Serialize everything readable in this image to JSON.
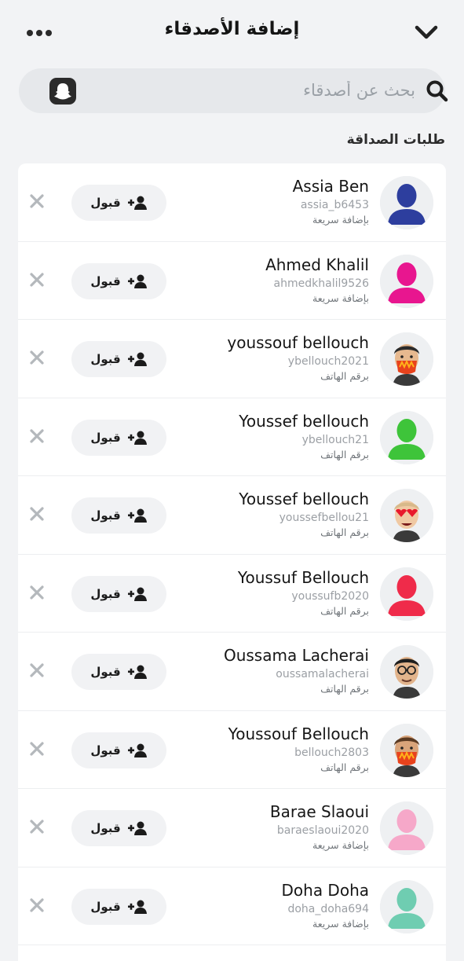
{
  "header": {
    "title": "إضافة الأصدقاء",
    "more_icon": "more-dots-icon",
    "back_icon": "chevron-down-icon"
  },
  "search": {
    "placeholder": "بحث عن أصدقاء",
    "icon": "search-icon",
    "left_icon": "snapchat-ghost-icon"
  },
  "section": {
    "label": "طلبات الصداقة"
  },
  "requests": [
    {
      "name": "Assia Ben",
      "username": "assia_b6453",
      "source": "بإضافة سريعة",
      "accept_label": "قبول",
      "avatar": {
        "type": "silhouette",
        "color": "#2d3e9e"
      }
    },
    {
      "name": "Ahmed Khalil",
      "username": "ahmedkhalil9526",
      "source": "بإضافة سريعة",
      "accept_label": "قبول",
      "avatar": {
        "type": "silhouette",
        "color": "#e8168f"
      }
    },
    {
      "name": "youssouf bellouch",
      "username": "ybellouch2021",
      "source": "برقم الهاتف",
      "accept_label": "قبول",
      "avatar": {
        "type": "bitmoji",
        "skin": "#e7b98f",
        "hair": "#2b2b2b",
        "feature": "fire-mask"
      }
    },
    {
      "name": "Youssef bellouch",
      "username": "ybellouch21",
      "source": "برقم الهاتف",
      "accept_label": "قبول",
      "avatar": {
        "type": "silhouette",
        "color": "#3ec43a"
      }
    },
    {
      "name": "Youssef bellouch",
      "username": "youssefbellou21",
      "source": "برقم الهاتف",
      "accept_label": "قبول",
      "avatar": {
        "type": "bitmoji",
        "skin": "#f0c9a3",
        "hair": "#d8b98a",
        "feature": "heart-eyes"
      }
    },
    {
      "name": "Youssuf Bellouch",
      "username": "youssufb2020",
      "source": "برقم الهاتف",
      "accept_label": "قبول",
      "avatar": {
        "type": "silhouette",
        "color": "#ef2b4a"
      }
    },
    {
      "name": "Oussama Lacherai",
      "username": "oussamalacherai",
      "source": "برقم الهاتف",
      "accept_label": "قبول",
      "avatar": {
        "type": "bitmoji",
        "skin": "#e2b48c",
        "hair": "#1e1e1e",
        "feature": "glasses"
      }
    },
    {
      "name": "Youssouf Bellouch",
      "username": "bellouch2803",
      "source": "برقم الهاتف",
      "accept_label": "قبول",
      "avatar": {
        "type": "bitmoji",
        "skin": "#d9a47a",
        "hair": "#5a3a22",
        "feature": "fire-mask"
      }
    },
    {
      "name": "Barae Slaoui",
      "username": "baraeslaoui2020",
      "source": "بإضافة سريعة",
      "accept_label": "قبول",
      "avatar": {
        "type": "silhouette",
        "color": "#f6a8c9"
      }
    },
    {
      "name": "Doha Doha",
      "username": "doha_doha694",
      "source": "بإضافة سريعة",
      "accept_label": "قبول",
      "avatar": {
        "type": "silhouette",
        "color": "#6fcdb1"
      }
    }
  ]
}
